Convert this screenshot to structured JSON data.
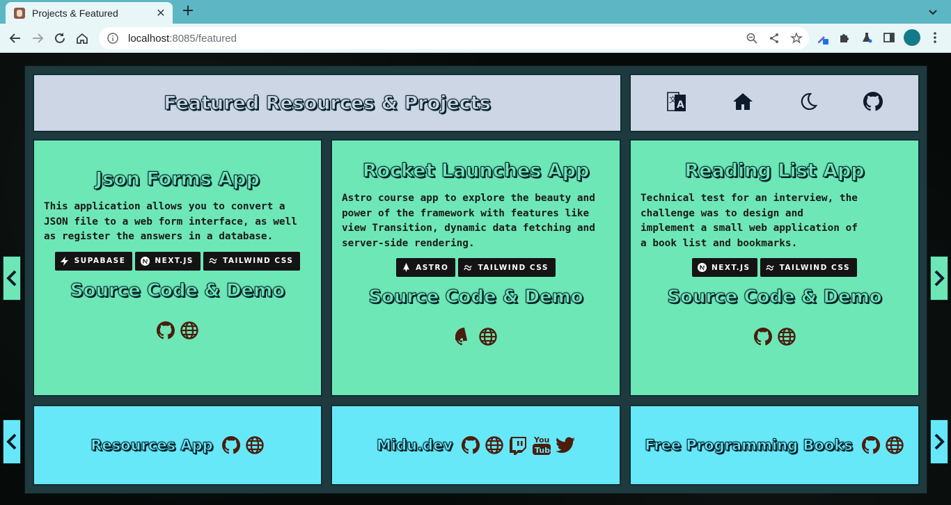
{
  "browser": {
    "tab_title": "Projects & Featured",
    "url_host": "localhost",
    "url_path": ":8085/featured"
  },
  "header": {
    "title": "Featured Resources & Projects",
    "icons": [
      "translate-icon",
      "home-icon",
      "moon-icon",
      "github-icon"
    ]
  },
  "projects": [
    {
      "title": "Json Forms App",
      "description": "This application allows you to convert a JSON file to a web form interface, as well as register the answers in a database.",
      "tags": [
        "SUPABASE",
        "NEXT.JS",
        "TAILWIND CSS"
      ],
      "source_label": "Source Code & Demo"
    },
    {
      "title": "Rocket Launches App",
      "description": "Astro course app to explore the beauty and power of the framework with features like view Transition, dynamic data fetching and server-side rendering.",
      "tags": [
        "ASTRO",
        "TAILWIND CSS"
      ],
      "source_label": "Source Code & Demo"
    },
    {
      "title": "Reading List App",
      "description": "Technical test for an interview, the challenge was to design and implement a small web application of a book list and bookmarks.",
      "tags": [
        "NEXT.JS",
        "TAILWIND CSS"
      ],
      "source_label": "Source Code & Demo"
    }
  ],
  "resources": [
    {
      "title": "Resources App"
    },
    {
      "title": "Midu.dev"
    },
    {
      "title": "Free Programming Books"
    }
  ],
  "colors": {
    "card_green": "#6ee7b7",
    "card_cyan": "#67e8f9",
    "header_bg": "#cdd6e4",
    "icon_brown": "#4a1d0c"
  }
}
